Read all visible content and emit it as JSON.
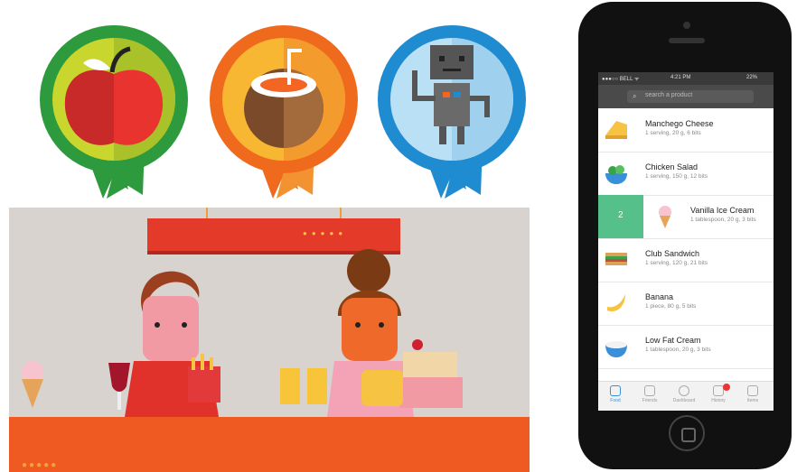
{
  "badges": [
    {
      "name": "apple-badge",
      "icon": "apple-icon",
      "ring": "#2d9a3e",
      "inner": "#c9d62e"
    },
    {
      "name": "coconut-badge",
      "icon": "coconut-icon",
      "ring": "#f06a1e",
      "inner": "#f7b733"
    },
    {
      "name": "robot-badge",
      "icon": "robot-icon",
      "ring": "#1f8bd0",
      "inner": "#b9e0f5"
    }
  ],
  "phone": {
    "status": {
      "carrier": "●●●○○ BELL ᯤ",
      "time": "4:21 PM",
      "battery": "22%"
    },
    "search": {
      "placeholder": "search a product"
    },
    "items": [
      {
        "name": "Manchego Cheese",
        "meta": "1 serving, 20 g, 6 bits",
        "icon": "cheese-icon"
      },
      {
        "name": "Chicken Salad",
        "meta": "1 serving, 150 g, 12 bits",
        "icon": "salad-icon"
      },
      {
        "name": "Vanilla Ice Cream",
        "meta": "1 tablespoon, 20 g, 3 bits",
        "icon": "ice-cream-icon",
        "swipe_value": "2"
      },
      {
        "name": "Club Sandwich",
        "meta": "1 serving, 120 g, 21 bits",
        "icon": "sandwich-icon"
      },
      {
        "name": "Banana",
        "meta": "1 piece, 80 g, 5 bits",
        "icon": "banana-icon"
      },
      {
        "name": "Low Fat Cream",
        "meta": "1 tablespoon, 20 g, 3 bits",
        "icon": "cream-icon"
      }
    ],
    "tabs": [
      {
        "label": "Food",
        "icon": "food-icon",
        "active": true
      },
      {
        "label": "Friends",
        "icon": "friends-icon",
        "active": false
      },
      {
        "label": "Dashboard",
        "icon": "dashboard-icon",
        "active": false
      },
      {
        "label": "History",
        "icon": "history-icon",
        "active": false
      },
      {
        "label": "Items",
        "icon": "items-icon",
        "active": false
      }
    ]
  },
  "scene": {
    "accent": "#ef5a22",
    "shelf": "#e33a2a",
    "background": "#d8d3cf"
  }
}
